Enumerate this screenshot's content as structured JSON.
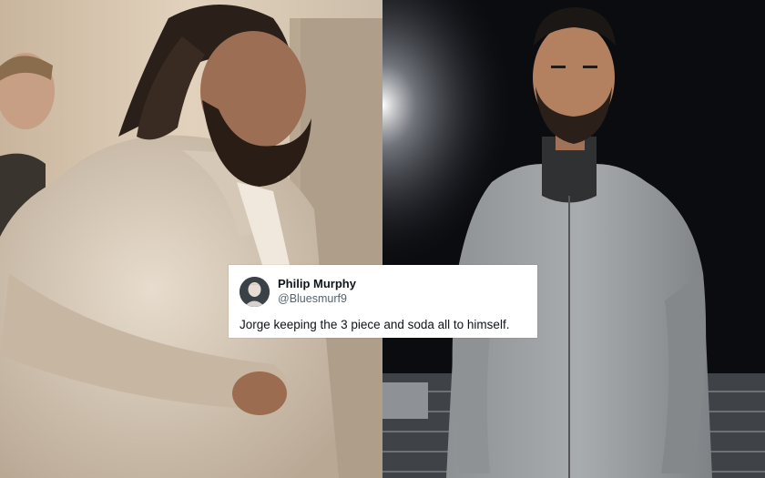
{
  "tweet": {
    "display_name": "Philip Murphy",
    "handle": "@Bluesmurf9",
    "text": "Jorge keeping the 3 piece and soda all to himself."
  },
  "images": {
    "left": "video-still-bearded-man-in-beige-jacket",
    "right": "portrait-bearded-man-in-grey-zip-jacket-stadium-night"
  },
  "colors": {
    "card_bg": "#ffffff",
    "name": "#0f1419",
    "handle": "#536471"
  }
}
